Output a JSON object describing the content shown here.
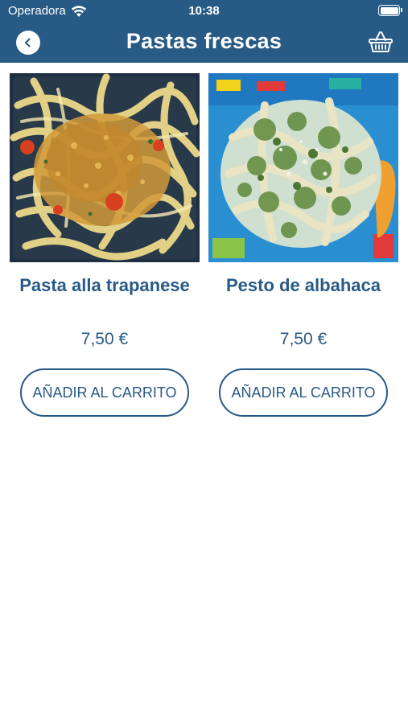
{
  "status_bar": {
    "carrier": "Operadora",
    "time": "10:38",
    "wifi_icon": "wifi-icon",
    "battery_icon": "battery-icon",
    "battery_level": 1.0
  },
  "header": {
    "title": "Pastas frescas",
    "back_icon": "chevron-left-icon",
    "cart_icon": "shopping-basket-icon"
  },
  "products": [
    {
      "name": "Pasta alla trapanese",
      "price": "7,50 €",
      "button_label": "AÑADIR AL CARRITO"
    },
    {
      "name": "Pesto de albahaca",
      "price": "7,50 €",
      "button_label": "AÑADIR AL CARRITO"
    }
  ],
  "colors": {
    "brand": "#285a86",
    "background": "#ffffff",
    "header_text": "#ffffff"
  }
}
